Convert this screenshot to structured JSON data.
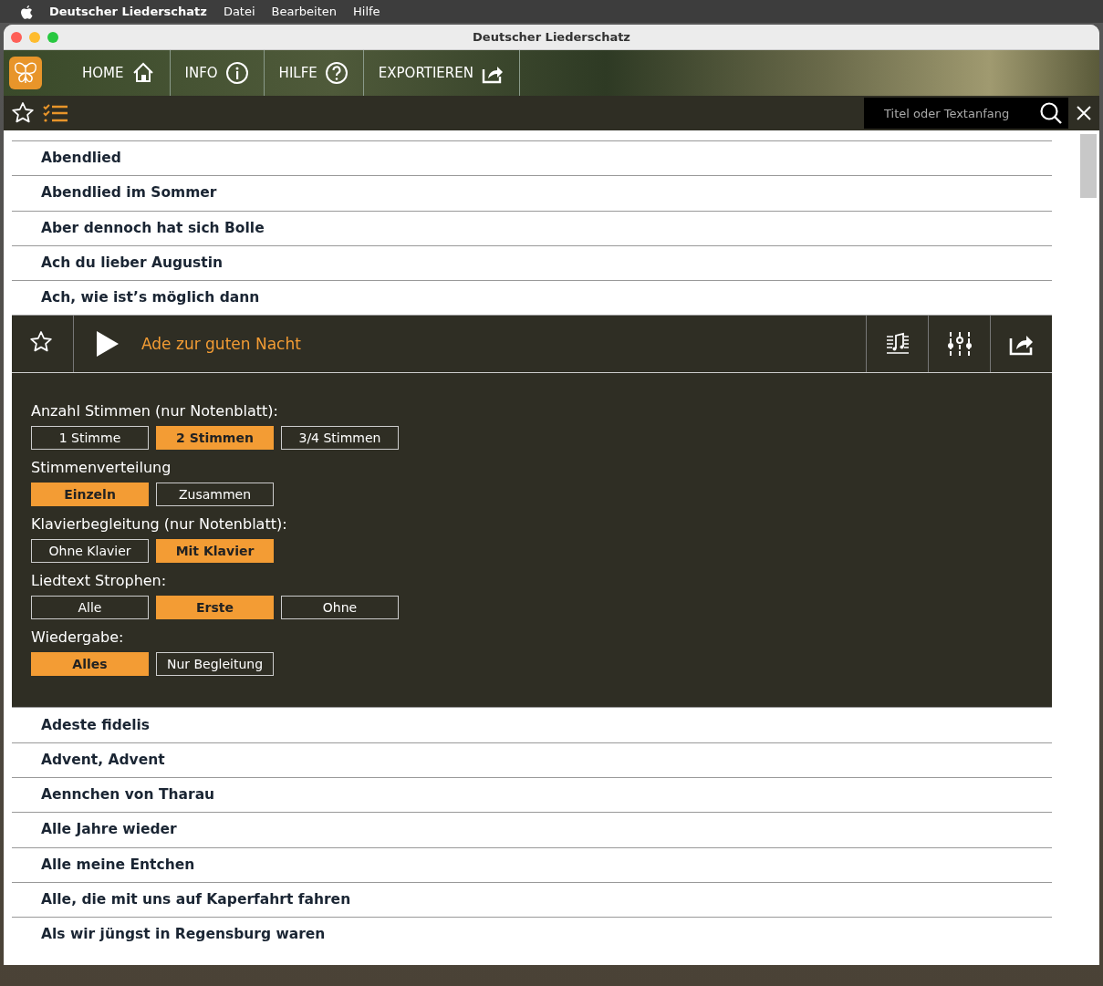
{
  "menubar": {
    "app_name": "Deutscher Liederschatz",
    "items": [
      "Datei",
      "Bearbeiten",
      "Hilfe"
    ]
  },
  "window": {
    "title": "Deutscher Liederschatz"
  },
  "nav": [
    {
      "label": "HOME",
      "kind": "home"
    },
    {
      "label": "INFO",
      "kind": "info"
    },
    {
      "label": "HILFE",
      "kind": "help"
    },
    {
      "label": "EXPORTIEREN",
      "kind": "export"
    }
  ],
  "search": {
    "placeholder": "Titel oder Textanfang"
  },
  "songs_before": [
    "Abendlied",
    "Abendlied im Sommer",
    "Aber dennoch hat sich Bolle",
    "Ach du lieber Augustin",
    "Ach, wie ist’s möglich dann"
  ],
  "expanded": {
    "title": "Ade zur guten Nacht",
    "favorite": false,
    "options": [
      {
        "label": "Anzahl Stimmen (nur Notenblatt):",
        "buttons": [
          {
            "label": "1 Stimme",
            "selected": false
          },
          {
            "label": "2 Stimmen",
            "selected": true
          },
          {
            "label": "3/4 Stimmen",
            "selected": false
          }
        ]
      },
      {
        "label": "Stimmenverteilung",
        "buttons": [
          {
            "label": "Einzeln",
            "selected": true
          },
          {
            "label": "Zusammen",
            "selected": false
          }
        ]
      },
      {
        "label": "Klavierbegleitung (nur Notenblatt):",
        "buttons": [
          {
            "label": "Ohne Klavier",
            "selected": false
          },
          {
            "label": "Mit Klavier",
            "selected": true
          }
        ]
      },
      {
        "label": "Liedtext Strophen:",
        "buttons": [
          {
            "label": "Alle",
            "selected": false
          },
          {
            "label": "Erste",
            "selected": true
          },
          {
            "label": "Ohne",
            "selected": false
          }
        ]
      },
      {
        "label": "Wiedergabe:",
        "buttons": [
          {
            "label": "Alles",
            "selected": true
          },
          {
            "label": "Nur Begleitung",
            "selected": false
          }
        ]
      }
    ]
  },
  "songs_after": [
    "Adeste fidelis",
    "Advent, Advent",
    "Aennchen von Tharau",
    "Alle Jahre wieder",
    "Alle meine Entchen",
    "Alle, die mit uns auf Kaperfahrt fahren",
    "Als wir jüngst in Regensburg waren"
  ]
}
